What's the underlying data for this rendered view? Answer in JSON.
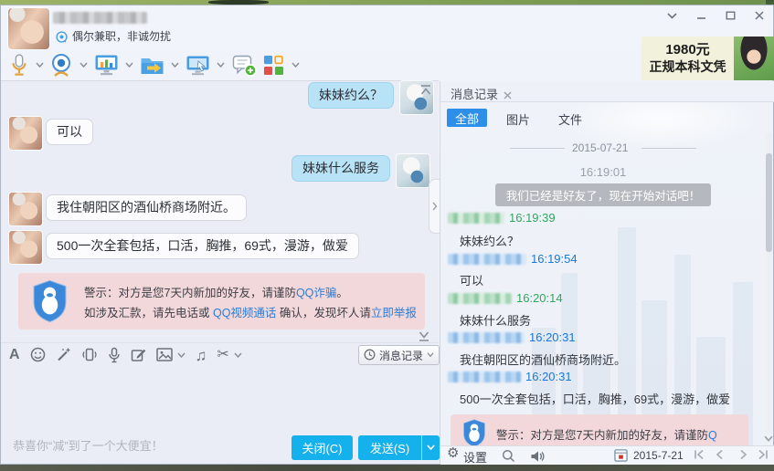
{
  "titlebar": {
    "signature": "偶尔兼职，非诚勿扰"
  },
  "ad": {
    "price": "1980元",
    "caption": "正规本科文凭"
  },
  "chat": {
    "messages": [
      {
        "side": "self",
        "text": "妹妹约么？"
      },
      {
        "side": "other",
        "text": "可以"
      },
      {
        "side": "self",
        "text": "妹妹什么服务"
      },
      {
        "side": "other",
        "text": "我住朝阳区的酒仙桥商场附近。"
      },
      {
        "side": "other",
        "text": "500一次全套包括，口活，胸推，69式，漫游，做爱"
      }
    ],
    "warning": {
      "line1_prefix": "警示：对方是您7天内新加的好友，请谨防",
      "line1_link": "QQ诈骗",
      "line1_suffix": "。",
      "line2_prefix": "如涉及汇款，请先电话或 ",
      "line2_link1": "QQ视频通话",
      "line2_mid": " 确认，发现坏人请",
      "line2_link2": "立即举报"
    }
  },
  "composer": {
    "history_button": "消息记录",
    "promo_text": "恭喜你“减”到了一个大便宜！",
    "close_button": "关闭(C)",
    "send_button": "发送(S)"
  },
  "history": {
    "tab_title": "消息记录",
    "filters": [
      {
        "label": "全部"
      },
      {
        "label": "图片"
      },
      {
        "label": "文件"
      }
    ],
    "date_divider": "2015-07-21",
    "time_header": "16:19:01",
    "system_notice": "我们已经是好友了，现在开始对话吧！",
    "records": [
      {
        "who": "self",
        "time": "16:19:39",
        "text": "妹妹约么？"
      },
      {
        "who": "other",
        "time": "16:19:54",
        "text": "可以"
      },
      {
        "who": "self",
        "time": "16:20:14",
        "text": "妹妹什么服务"
      },
      {
        "who": "other",
        "time": "16:20:31",
        "text": "我住朝阳区的酒仙桥商场附近。"
      },
      {
        "who": "other",
        "time": "16:20:31",
        "text": "500一次全套包括，口活，胸推，69式，漫游，做爱"
      }
    ],
    "warning_prefix": "警示：对方是您7天内新加的好友，请谨防",
    "warning_link": "Q"
  },
  "footer": {
    "settings": "设置",
    "date": "2015-7-21"
  },
  "icons": {
    "font": "A",
    "music": "♫",
    "scissors": "✂",
    "gear": "⚙"
  },
  "colors": {
    "accent_blue": "#14b1ec",
    "selected_tab": "#2e8fe8",
    "link": "#2b7cd6",
    "self_time_green": "#2fa75e",
    "other_time_blue": "#1a78d9",
    "warning_bg": "#f3d8db",
    "bubble_self": "#b8e2f5"
  }
}
